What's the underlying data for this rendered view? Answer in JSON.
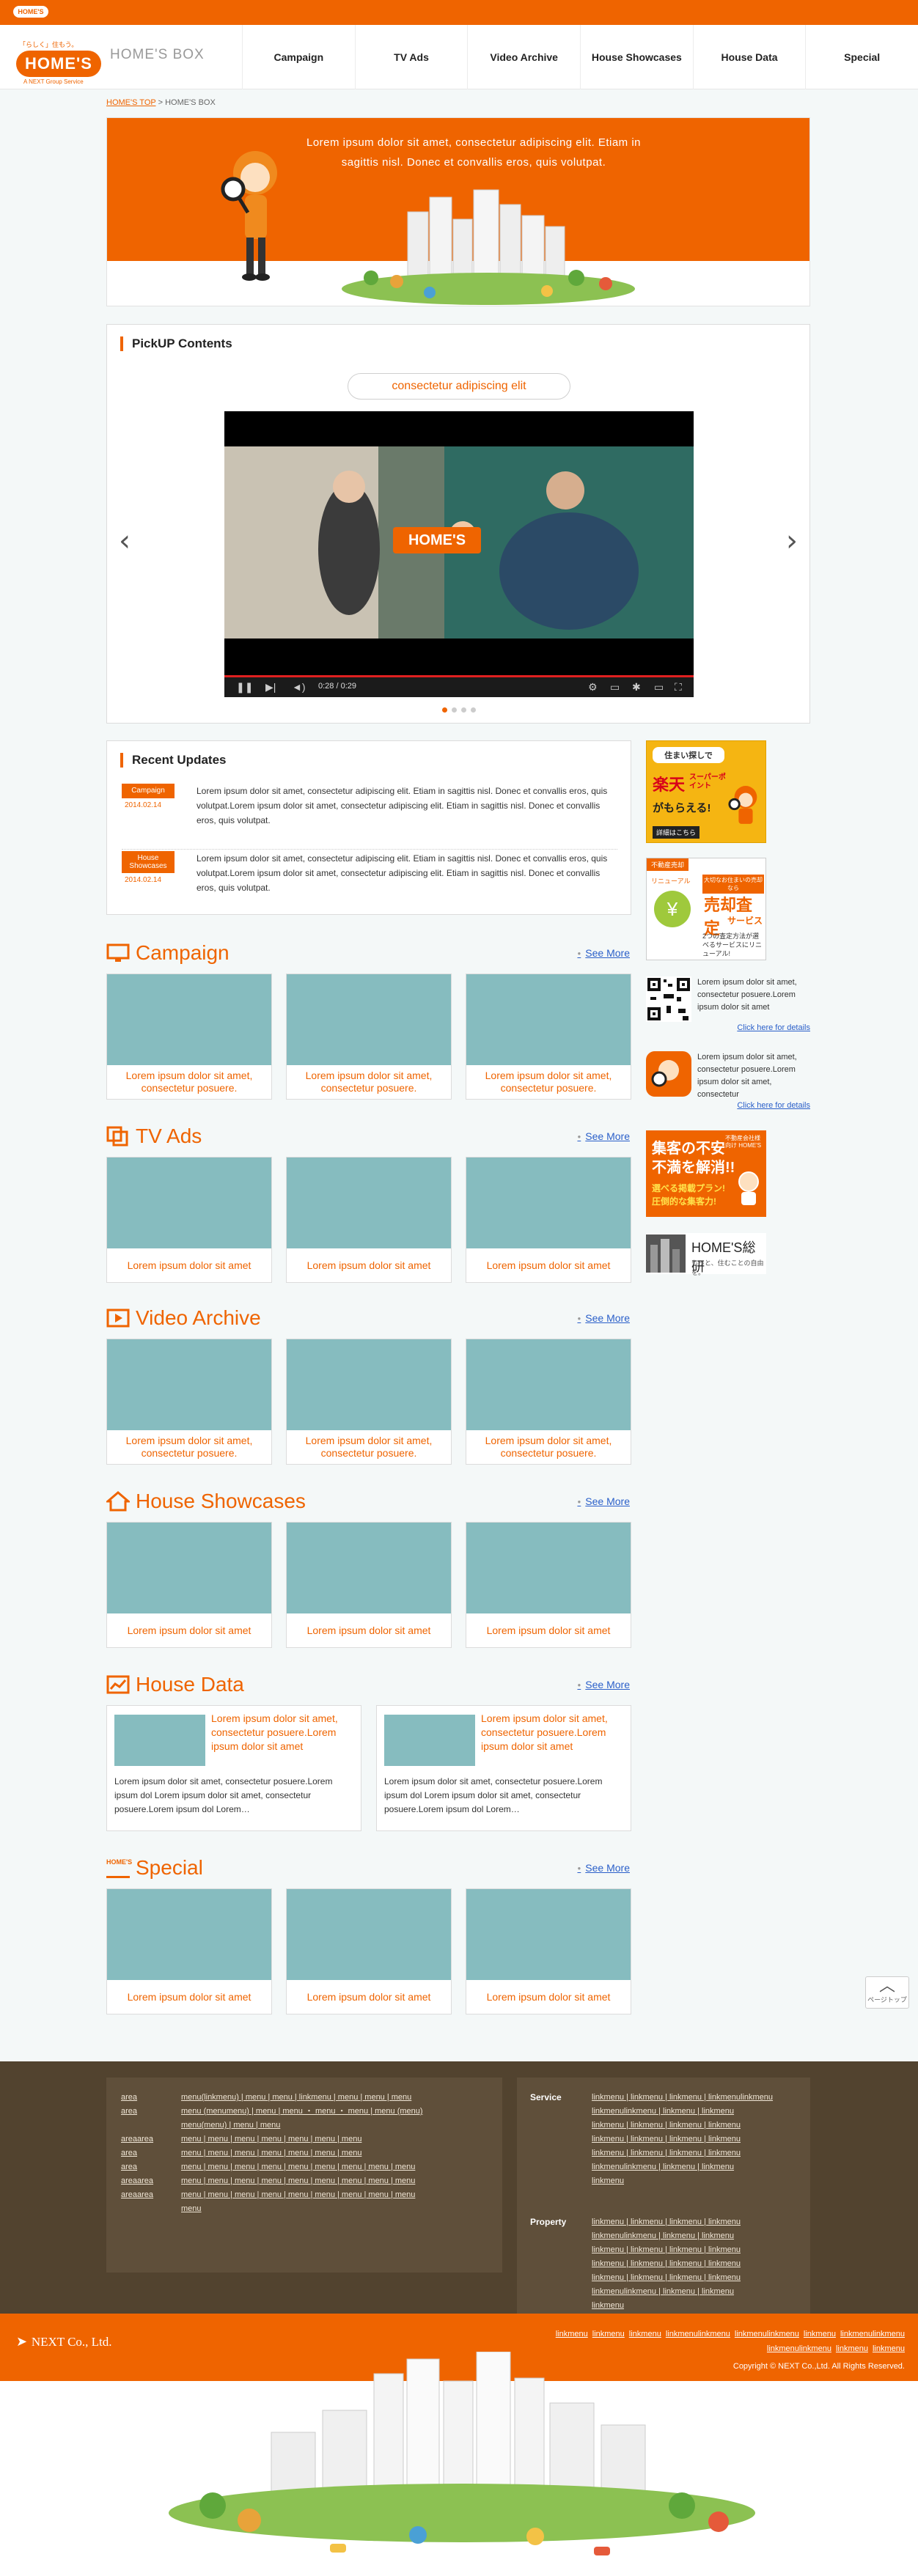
{
  "topbar": {
    "mini_logo": "HOME'S"
  },
  "header": {
    "logo_tag": "「らしく」住もう。",
    "logo_text": "HOME'S",
    "logo_sub": "A NEXT Group Service",
    "brand": "HOME'S BOX",
    "nav": [
      "Campaign",
      "TV Ads",
      "Video Archive",
      "House Showcases",
      "House Data",
      "Special"
    ]
  },
  "breadcrumb": {
    "top": "HOME'S TOP",
    "sep": ">",
    "current": "HOME'S BOX"
  },
  "hero": {
    "text": "Lorem ipsum dolor sit amet, consectetur adipiscing elit. Etiam in sagittis nisl. Donec et convallis eros, quis volutpat."
  },
  "pickup": {
    "title": "PickUP Contents",
    "pill": "consectetur adipiscing elit",
    "video_logo": "HOME'S",
    "video_time": "0:28 / 0:29",
    "prev": "‹",
    "next": "›",
    "dot_count": 4,
    "active_dot": 0
  },
  "updates": {
    "title": "Recent Updates",
    "items": [
      {
        "category": "Campaign",
        "date": "2014.02.14",
        "text": "Lorem ipsum dolor sit amet, consectetur adipiscing elit. Etiam in sagittis nisl. Donec et convallis eros, quis volutpat.Lorem ipsum dolor sit amet, consectetur adipiscing elit. Etiam in sagittis nisl. Donec et convallis eros, quis volutpat."
      },
      {
        "category": "House Showcases",
        "date": "2014.02.14",
        "text": "Lorem ipsum dolor sit amet, consectetur adipiscing elit. Etiam in sagittis nisl. Donec et convallis eros, quis volutpat.Lorem ipsum dolor sit amet, consectetur adipiscing elit. Etiam in sagittis nisl. Donec et convallis eros, quis volutpat."
      }
    ]
  },
  "see_more": "See More",
  "sections": {
    "campaign": {
      "title": "Campaign",
      "cards": [
        "Lorem ipsum dolor sit amet, consectetur posuere.",
        "Lorem ipsum dolor sit amet, consectetur posuere.",
        "Lorem ipsum dolor sit amet, consectetur posuere."
      ]
    },
    "tvads": {
      "title": "TV Ads",
      "cards": [
        "Lorem ipsum dolor sit amet",
        "Lorem ipsum dolor sit amet",
        "Lorem ipsum dolor sit amet"
      ]
    },
    "video": {
      "title": "Video Archive",
      "cards": [
        "Lorem ipsum dolor sit amet, consectetur posuere.",
        "Lorem ipsum dolor sit amet, consectetur posuere.",
        "Lorem ipsum dolor sit amet, consectetur posuere."
      ]
    },
    "showcases": {
      "title": "House Showcases",
      "cards": [
        "Lorem ipsum dolor sit amet",
        "Lorem ipsum dolor sit amet",
        "Lorem ipsum dolor sit amet"
      ]
    },
    "housedata": {
      "title": "House Data",
      "cards": [
        {
          "title": "Lorem ipsum dolor sit amet, consectetur posuere.Lorem ipsum dolor sit amet",
          "body": "Lorem ipsum dolor sit amet, consectetur posuere.Lorem ipsum dol Lorem ipsum dolor sit amet, consectetur posuere.Lorem ipsum dol Lorem…"
        },
        {
          "title": "Lorem ipsum dolor sit amet, consectetur posuere.Lorem ipsum dolor sit amet",
          "body": "Lorem ipsum dolor sit amet, consectetur posuere.Lorem ipsum dol Lorem ipsum dolor sit amet, consectetur posuere.Lorem ipsum dol Lorem…"
        }
      ]
    },
    "special": {
      "title": "Special",
      "badge": "HOME'S",
      "cards": [
        "Lorem ipsum dolor sit amet",
        "Lorem ipsum dolor sit amet",
        "Lorem ipsum dolor sit amet"
      ]
    }
  },
  "sidebar": {
    "banner1": {
      "line1": "住まい探しで",
      "line2": "楽天",
      "line3": "スーパーポイント",
      "line4": "がもらえる!",
      "cta": "詳細はこちら"
    },
    "banner2": {
      "tag": "不動産売却",
      "line1": "大切なお住まいの売却なら",
      "line2": "売却査定",
      "line3": "サービス",
      "line4": "2つの査定方法が選べるサービスにリニューアル!",
      "renew": "リニューアル"
    },
    "promo1": {
      "text": "Lorem ipsum dolor sit amet, consectetur posuere.Lorem ipsum dolor sit amet",
      "link": "Click here for details"
    },
    "promo2": {
      "text": "Lorem ipsum dolor sit amet, consectetur posuere.Lorem ipsum dolor sit amet, consectetur",
      "link": "Click here for details"
    },
    "banner3": {
      "line1": "集客の不安",
      "line2": "不満を解消!!",
      "tag": "不動産会社様向け HOME'S",
      "line3": "選べる掲載プラン!",
      "line4": "圧倒的な集客力!"
    },
    "banner4": {
      "title": "HOME'S総研",
      "sub": "もっと、住むことの自由を。"
    }
  },
  "pagetop": {
    "label": "ページトップ"
  },
  "footer": {
    "left": {
      "rows": [
        {
          "k": "area",
          "v": "menu(linkmenu) | menu | menu | linkmenu | menu | menu | menu"
        },
        {
          "k": "area",
          "v": "menu (menumenu) | menu | menu ・ menu ・ menu | menu (menu)"
        },
        {
          "k": "",
          "v": "menu(menu) | menu | menu"
        },
        {
          "k": "areaarea",
          "v": "menu | menu | menu | menu | menu | menu | menu"
        },
        {
          "k": "area",
          "v": "menu | menu | menu | menu | menu | menu | menu"
        },
        {
          "k": "area",
          "v": "menu | menu | menu | menu | menu | menu | menu | menu | menu"
        },
        {
          "k": "areaarea",
          "v": "menu | menu | menu | menu | menu | menu | menu | menu | menu"
        },
        {
          "k": "areaarea",
          "v": "menu | menu | menu | menu | menu | menu | menu | menu | menu"
        },
        {
          "k": "",
          "v": "menu"
        }
      ]
    },
    "service": {
      "title": "Service",
      "rows": [
        "linkmenu | linkmenu | linkmenu | linkmenulinkmenu",
        "linkmenulinkmenu | linkmenu | linkmenu",
        "linkmenu | linkmenu | linkmenu | linkmenu",
        "linkmenu | linkmenu | linkmenu | linkmenu",
        "linkmenu | linkmenu | linkmenu | linkmenu",
        "linkmenulinkmenu | linkmenu | linkmenu",
        "linkmenu"
      ]
    },
    "property": {
      "title": "Property",
      "rows": [
        "linkmenu | linkmenu | linkmenu | linkmenu",
        "linkmenulinkmenu | linkmenu | linkmenu",
        "linkmenu | linkmenu | linkmenu | linkmenu",
        "linkmenu | linkmenu | linkmenu | linkmenu",
        "linkmenu | linkmenu | linkmenu | linkmenu",
        "linkmenulinkmenu | linkmenu | linkmenu",
        "linkmenu"
      ]
    }
  },
  "corp": {
    "name": "NEXT Co., Ltd.",
    "links_row1": [
      "linkmenu",
      "linkmenu",
      "linkmenu",
      "linkmenulinkmenu",
      "linkmenulinkmenu",
      "linkmenu",
      "linkmenulinkmenu"
    ],
    "links_row2": [
      "linkmenulinkmenu",
      "linkmenu",
      "linkmenu"
    ],
    "copyright": "Copyright © NEXT Co.,Ltd. All Rights Reserved."
  },
  "colors": {
    "brand": "#ef6400",
    "thumb": "#86bcbf",
    "footer": "#52432f",
    "link": "#2a5fc9"
  }
}
